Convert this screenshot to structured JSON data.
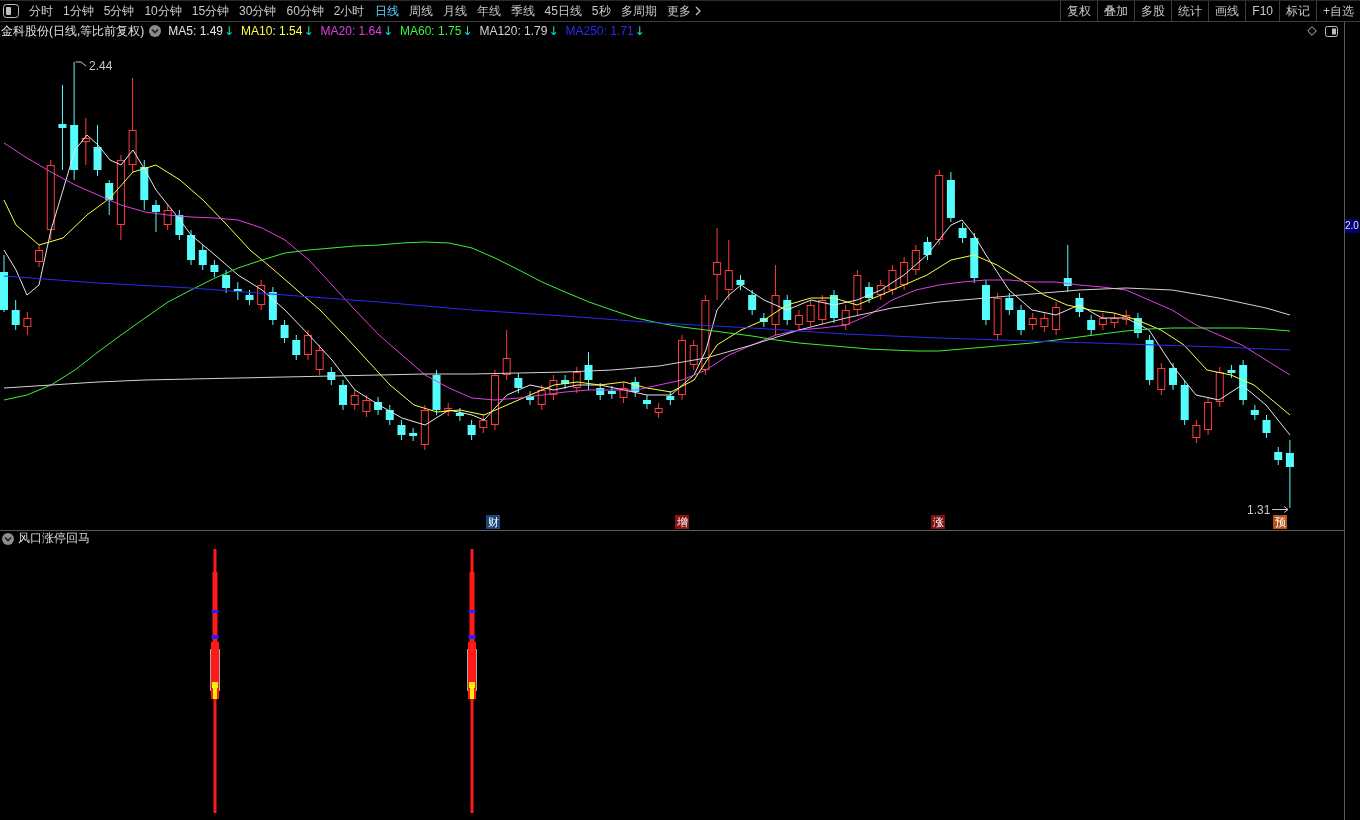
{
  "toolbar": {
    "periods": [
      {
        "label": "分时",
        "selected": false
      },
      {
        "label": "1分钟",
        "selected": false
      },
      {
        "label": "5分钟",
        "selected": false
      },
      {
        "label": "10分钟",
        "selected": false
      },
      {
        "label": "15分钟",
        "selected": false
      },
      {
        "label": "30分钟",
        "selected": false
      },
      {
        "label": "60分钟",
        "selected": false
      },
      {
        "label": "2小时",
        "selected": false
      },
      {
        "label": "日线",
        "selected": true
      },
      {
        "label": "周线",
        "selected": false
      },
      {
        "label": "月线",
        "selected": false
      },
      {
        "label": "年线",
        "selected": false
      },
      {
        "label": "季线",
        "selected": false
      },
      {
        "label": "45日线",
        "selected": false
      },
      {
        "label": "5秒",
        "selected": false
      },
      {
        "label": "多周期",
        "selected": false
      }
    ],
    "more": "更多",
    "actions": [
      "复权",
      "叠加",
      "多股",
      "统计",
      "画线",
      "F10",
      "标记",
      "+自选"
    ]
  },
  "main_chart": {
    "title": "金科股份(日线,等比前复权)",
    "moving_averages": [
      {
        "label": "MA5: 1.49",
        "color": "#e6e6e6",
        "arrow": "↓"
      },
      {
        "label": "MA10: 1.54",
        "color": "#ffff3c",
        "arrow": "↓"
      },
      {
        "label": "MA20: 1.64",
        "color": "#e040e0",
        "arrow": "↓"
      },
      {
        "label": "MA60: 1.75",
        "color": "#3cf03c",
        "arrow": "↓"
      },
      {
        "label": "MA120: 1.79",
        "color": "#d2d2d2",
        "arrow": "↓"
      },
      {
        "label": "MA250: 1.71",
        "color": "#2a2af0",
        "arrow": "↓"
      }
    ],
    "axis_label": "2.0",
    "high_label": "2.44",
    "low_label": "1.31",
    "event_markers": [
      {
        "label": "财",
        "color": "#1c4677"
      },
      {
        "label": "增",
        "color": "#8a1212"
      },
      {
        "label": "涨",
        "color": "#7d1010"
      },
      {
        "label": "预",
        "color": "#b4531c"
      }
    ]
  },
  "indicator_panel": {
    "title": "风口涨停回马"
  }
}
